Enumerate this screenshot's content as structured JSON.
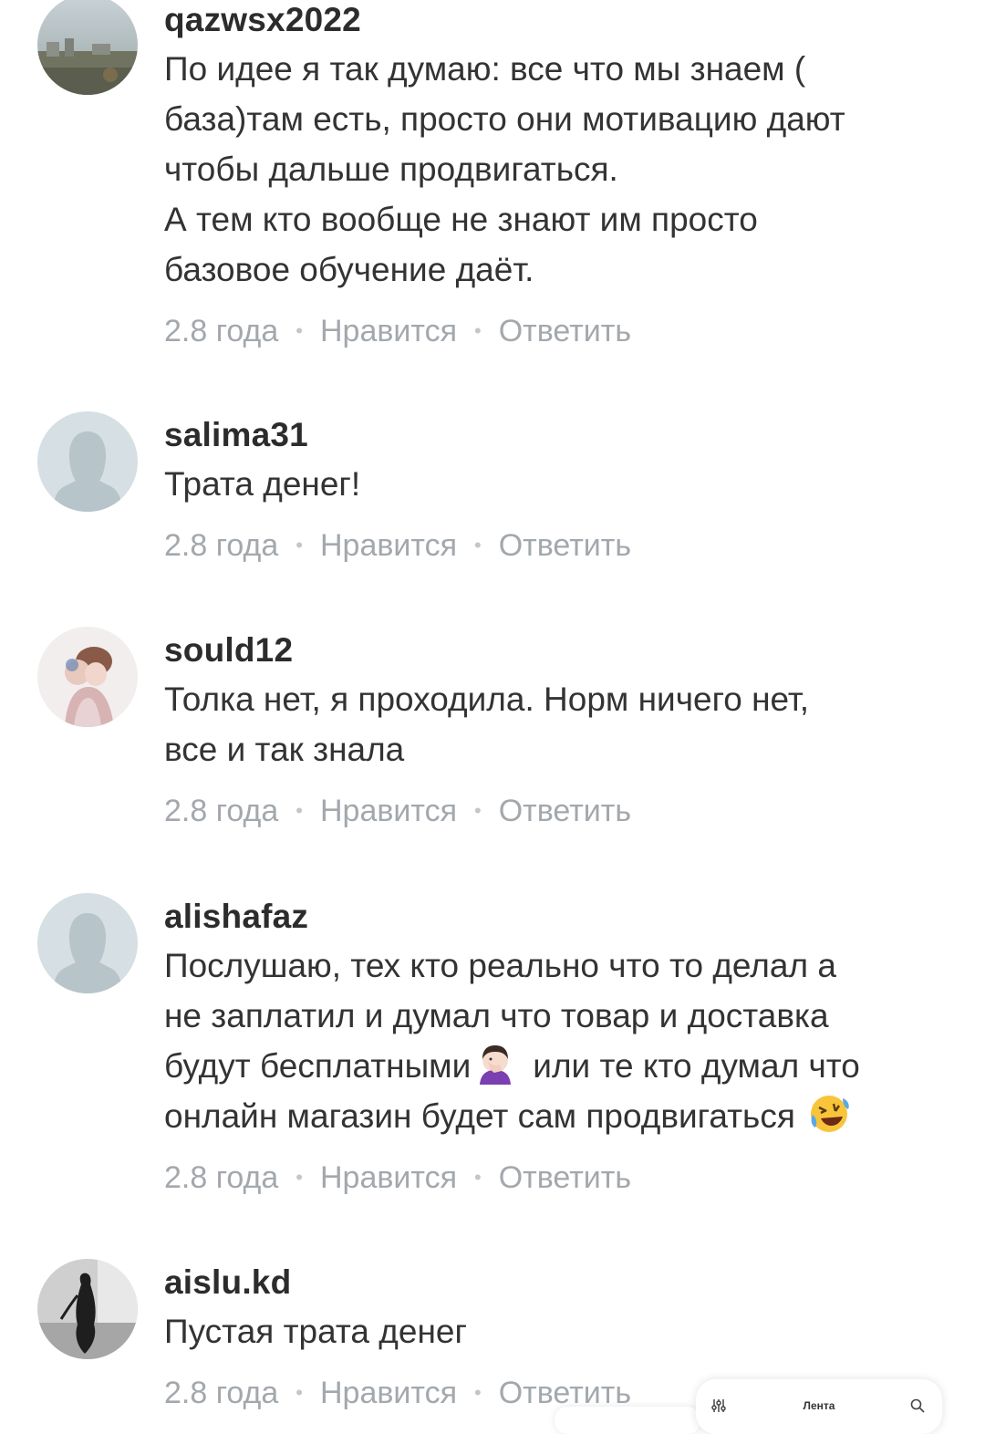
{
  "comments": [
    {
      "username": "qazwsx2022",
      "lines": [
        "По идее я так думаю: все что мы знаем (",
        "база)там есть, просто они мотивацию дают",
        "чтобы дальше продвигаться.",
        "А тем кто вообще не знают им просто",
        "базовое обучение даёт."
      ],
      "time": "2.8 года",
      "like": "Нравится",
      "reply": "Ответить",
      "avatar": "photo-avatar-cityscape"
    },
    {
      "username": "salima31",
      "lines": [
        "Трата денег!"
      ],
      "time": "2.8 года",
      "like": "Нравится",
      "reply": "Ответить",
      "avatar": "default-avatar-silhouette"
    },
    {
      "username": "sould12",
      "lines": [
        "Толка нет, я проходила. Норм ничего нет,",
        "все и так знала"
      ],
      "time": "2.8 года",
      "like": "Нравится",
      "reply": "Ответить",
      "avatar": "photo-avatar-people"
    },
    {
      "username": "alishafaz",
      "lines": [
        "Послушаю, тех кто реально что то делал а",
        "не заплатил и думал что товар и доставка",
        "будут бесплатными",
        "или те кто думал что",
        "онлайн магазин будет сам продвигаться"
      ],
      "time": "2.8 года",
      "like": "Нравится",
      "reply": "Ответить",
      "avatar": "default-avatar-silhouette",
      "emojis": [
        "facepalm-emoji",
        "rolling-laughing-emoji"
      ]
    },
    {
      "username": "aislu.kd",
      "lines": [
        "Пустая трата денег"
      ],
      "time": "2.8 года",
      "like": "Нравится",
      "reply": "Ответить",
      "avatar": "photo-avatar-dark-figure"
    }
  ],
  "separator": "•",
  "nav": {
    "label": "Лента",
    "left_icon": "sliders-icon",
    "right_icon": "search-icon"
  }
}
